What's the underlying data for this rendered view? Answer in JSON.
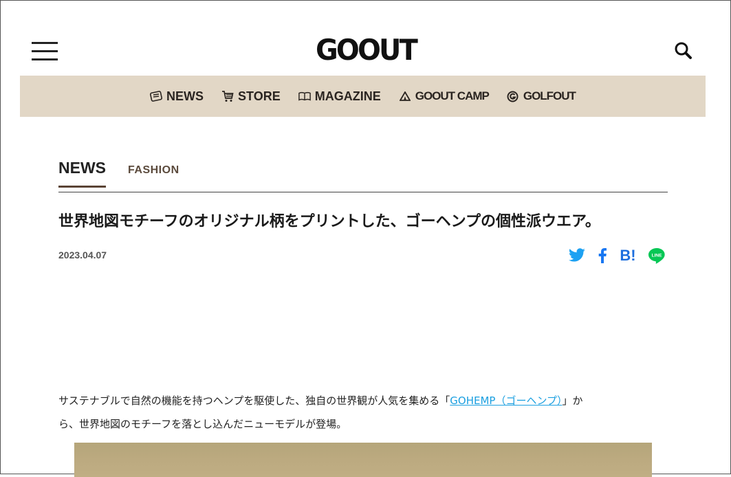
{
  "header": {
    "logo_text": "GOOUT",
    "menu_icon": "hamburger-menu-icon",
    "search_icon": "search-icon"
  },
  "nav": {
    "items": [
      {
        "label": "NEWS",
        "icon": "newspaper-icon"
      },
      {
        "label": "STORE",
        "icon": "cart-icon"
      },
      {
        "label": "MAGAZINE",
        "icon": "book-icon"
      },
      {
        "label": "GOOUT CAMP",
        "icon": "tent-icon"
      },
      {
        "label": "GOLFOUT",
        "icon": "golf-g-icon"
      }
    ],
    "background": "#e2d7c6"
  },
  "category": {
    "primary": "NEWS",
    "secondary": "FASHION"
  },
  "article": {
    "title": "世界地図モチーフのオリジナル柄をプリントした、ゴーヘンプの個性派ウエア。",
    "date": "2023.04.07",
    "body_before_link": "サステナブルで自然の機能を持つヘンプを駆使した、独自の世界観が人気を集める「",
    "link_text": "GOHEMP（ゴーヘンプ）",
    "body_after_link_line1": "」か",
    "body_line2": "ら、世界地図のモチーフを落とし込んだニューモデルが登場。"
  },
  "share": {
    "buttons": [
      {
        "name": "twitter",
        "color": "#1da1f2"
      },
      {
        "name": "facebook",
        "color": "#1877f2"
      },
      {
        "name": "hatena",
        "label": "B!",
        "color": "#1c6ede"
      },
      {
        "name": "line",
        "label": "LINE",
        "color": "#06c755"
      }
    ]
  }
}
